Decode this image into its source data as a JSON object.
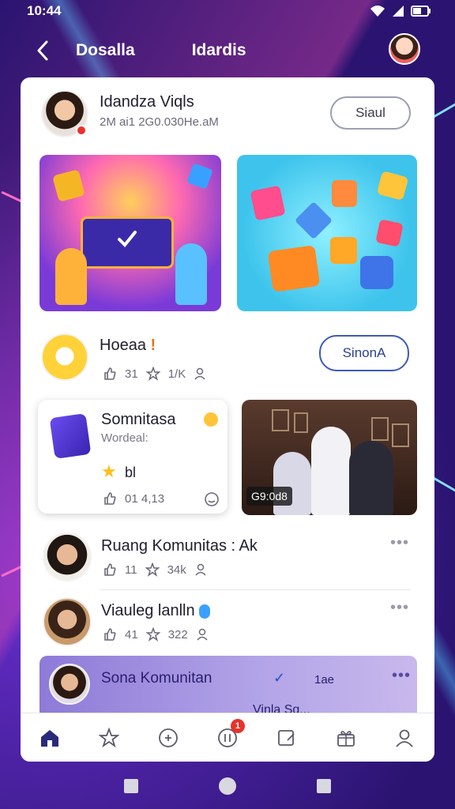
{
  "status_bar": {
    "time": "10:44"
  },
  "header": {
    "title": "Dosalla",
    "subtitle": "Idardis"
  },
  "top_post": {
    "name": "Idandza Viqls",
    "meta": "2M ai1 2G0.030He.aM",
    "action": "Siaul"
  },
  "second_post": {
    "name": "Hoeaa",
    "exclaim": "!",
    "stats": [
      "31",
      "1/K"
    ],
    "action": "SinonA"
  },
  "feature_card": {
    "title": "Somnitasa",
    "subtitle": "Wordeal:",
    "rating": "bl",
    "stats": "01 4,13",
    "video_time": "G9:0d8"
  },
  "list": [
    {
      "name": "Ruang Komunitas : Ak",
      "stats": [
        "11",
        "34k"
      ]
    },
    {
      "name": "Viauleg lanlln",
      "stats": [
        "41",
        "322"
      ]
    }
  ],
  "highlight": {
    "name": "Sona Komunitan",
    "tag": "1ae",
    "footer": "Vinla Sg..."
  },
  "bottom_nav": {
    "badge": "1"
  },
  "colors": {
    "accent": "#3e5ab8",
    "brand_purple": "#4a26a8",
    "badge_red": "#e8322c"
  }
}
